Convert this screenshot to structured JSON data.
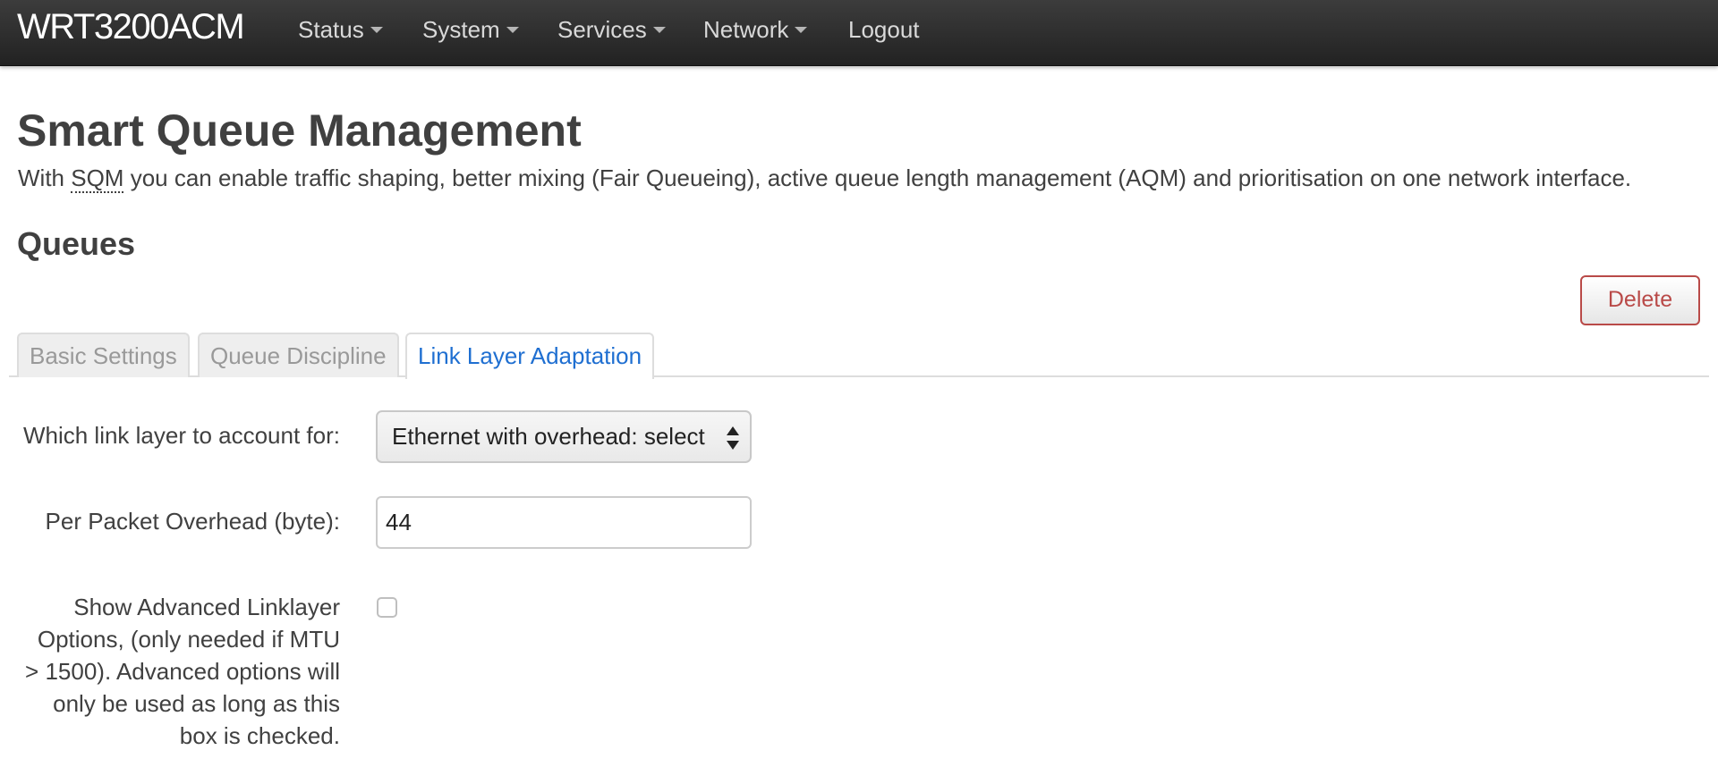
{
  "navbar": {
    "brand": "WRT3200ACM",
    "items": [
      {
        "label": "Status",
        "dropdown": true
      },
      {
        "label": "System",
        "dropdown": true
      },
      {
        "label": "Services",
        "dropdown": true
      },
      {
        "label": "Network",
        "dropdown": true
      },
      {
        "label": "Logout",
        "dropdown": false
      }
    ]
  },
  "page": {
    "title": "Smart Queue Management",
    "description_prefix": "With ",
    "description_abbr": "SQM",
    "description_suffix": " you can enable traffic shaping, better mixing (Fair Queueing), active queue length management (AQM) and prioritisation on one network interface."
  },
  "section": {
    "title": "Queues",
    "delete_label": "Delete"
  },
  "tabs": [
    {
      "label": "Basic Settings",
      "active": false
    },
    {
      "label": "Queue Discipline",
      "active": false
    },
    {
      "label": "Link Layer Adaptation",
      "active": true
    }
  ],
  "form": {
    "link_layer": {
      "label": "Which link layer to account for:",
      "value": "Ethernet with overhead: select"
    },
    "overhead": {
      "label": "Per Packet Overhead (byte):",
      "value": "44"
    },
    "advanced": {
      "label_lines": [
        "Show Advanced Linklayer",
        "Options, (only needed if MTU",
        "> 1500). Advanced options will",
        "only be used as long as this",
        "box is checked."
      ],
      "checked": false
    }
  },
  "colors": {
    "navbar_bg": "#2b2b2b",
    "active_tab": "#1f6fd1",
    "danger": "#b94a48"
  }
}
